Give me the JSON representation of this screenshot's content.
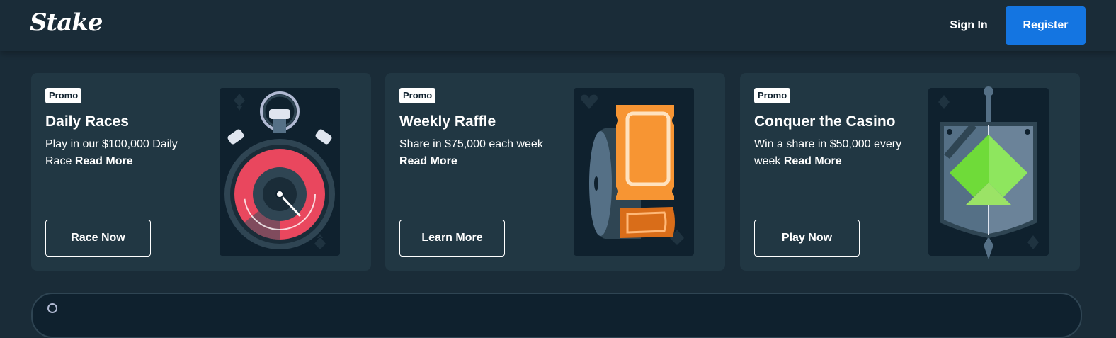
{
  "header": {
    "logo": "Stake",
    "signin_label": "Sign In",
    "register_label": "Register"
  },
  "promos": [
    {
      "badge": "Promo",
      "title": "Daily Races",
      "desc": "Play in our $100,000 Daily Race",
      "more": "Read More",
      "cta": "Race Now",
      "art_icon": "stopwatch-icon"
    },
    {
      "badge": "Promo",
      "title": "Weekly Raffle",
      "desc": "Share in $75,000 each week",
      "more": "Read More",
      "cta": "Learn More",
      "art_icon": "raffle-ticket-icon"
    },
    {
      "badge": "Promo",
      "title": "Conquer the Casino",
      "desc": "Win a share in $50,000 every week",
      "more": "Read More",
      "cta": "Play Now",
      "art_icon": "shield-sword-icon"
    }
  ],
  "colors": {
    "background": "#1a2c38",
    "card": "#213743",
    "accent_blue": "#1475e1",
    "art_background": "#0f212e"
  }
}
